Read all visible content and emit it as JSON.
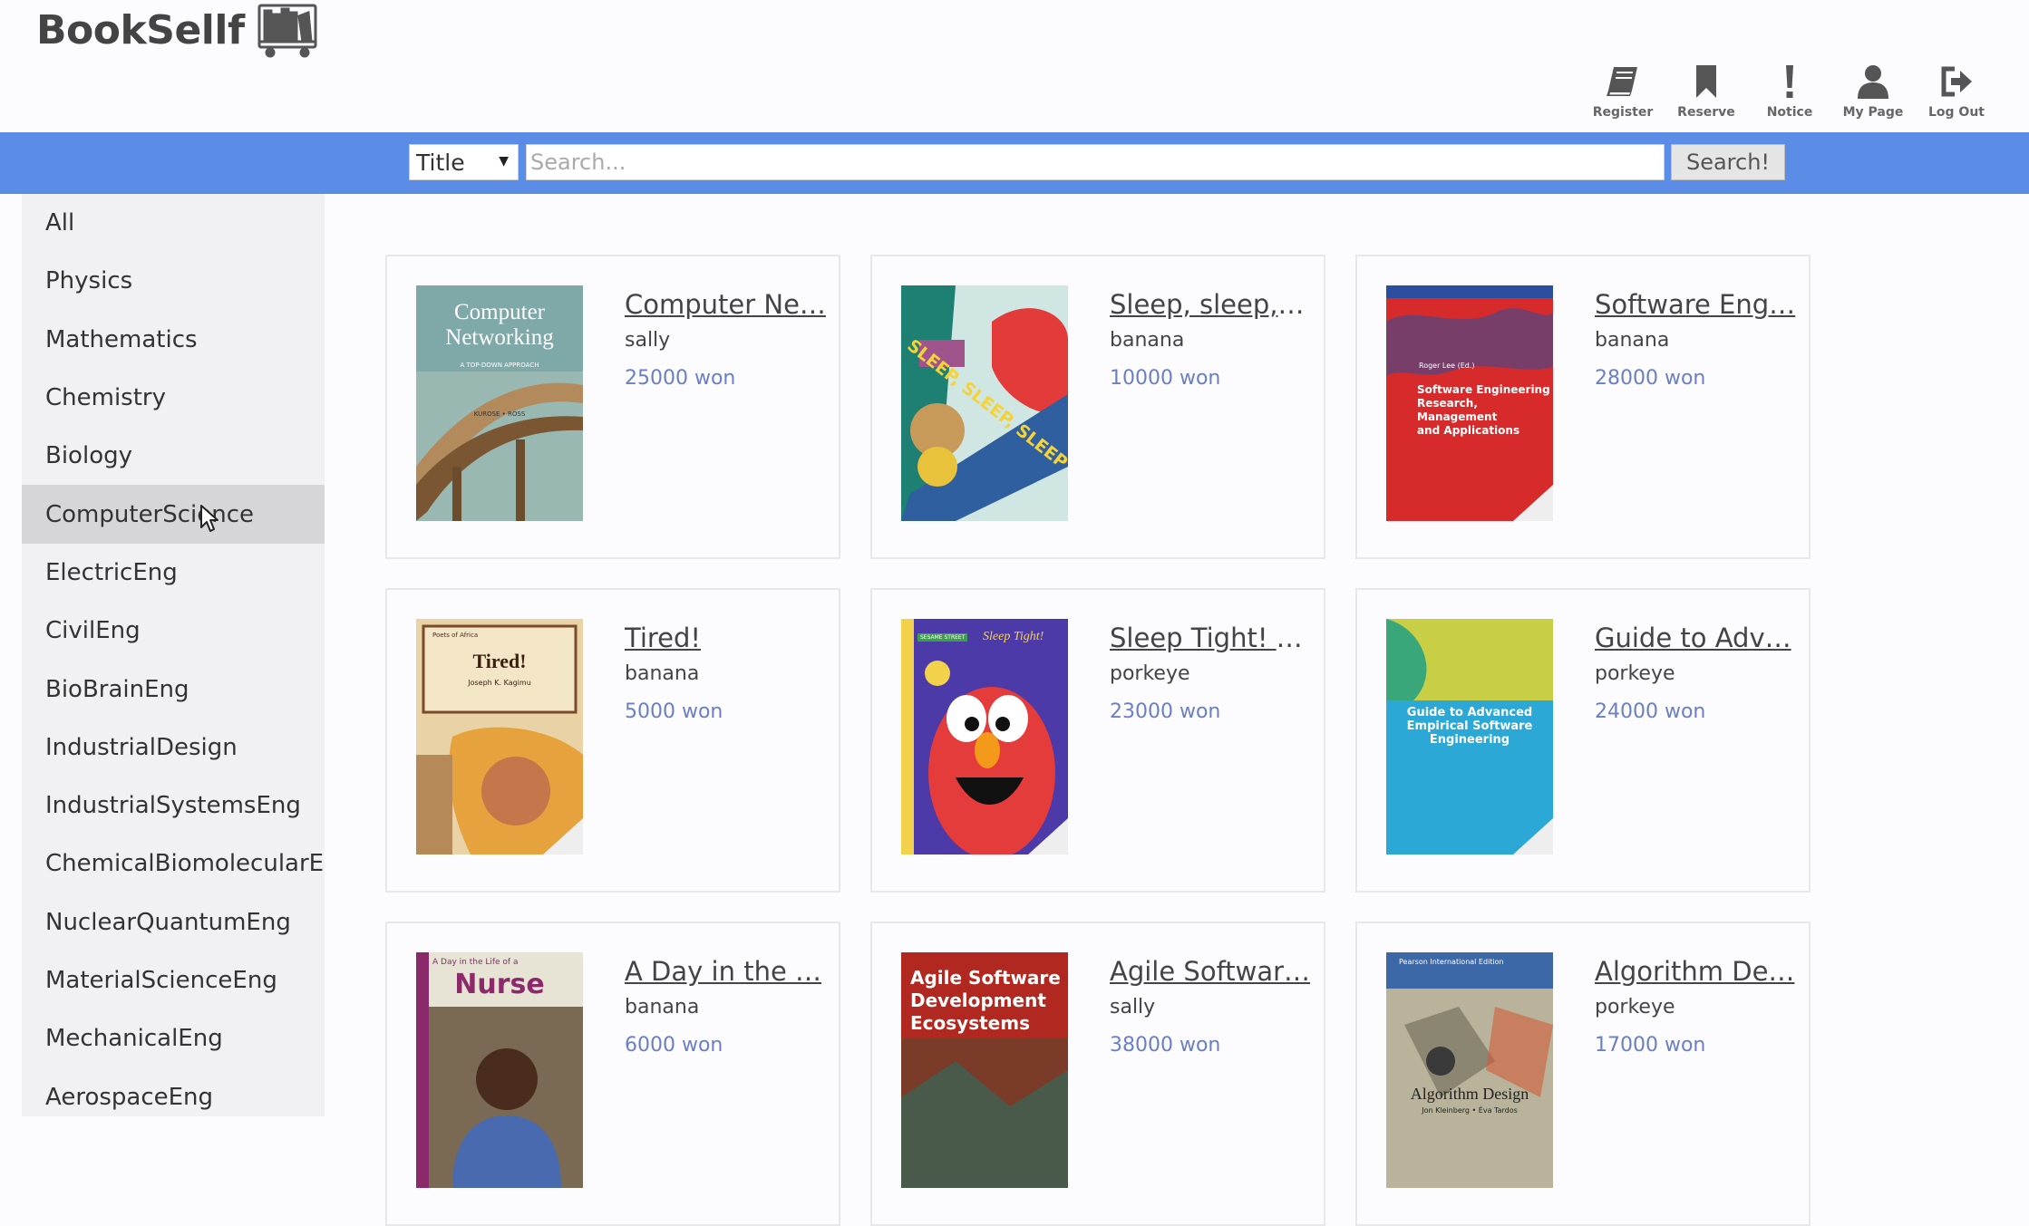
{
  "app": {
    "logo_text": "BookSellf"
  },
  "nav": [
    {
      "label": "Register",
      "icon": "book-icon"
    },
    {
      "label": "Reserve",
      "icon": "bookmark-icon"
    },
    {
      "label": "Notice",
      "icon": "exclamation-icon"
    },
    {
      "label": "My Page",
      "icon": "user-icon"
    },
    {
      "label": "Log Out",
      "icon": "logout-icon"
    }
  ],
  "search": {
    "field_value": "Title",
    "placeholder": "Search...",
    "button_label": "Search!"
  },
  "colors": {
    "search_bar": "#5b8de6",
    "price": "#6a7fc6",
    "sidebar": "#f1f0f2",
    "sidebar_active": "#d6d5d8"
  },
  "categories": [
    "All",
    "Physics",
    "Mathematics",
    "Chemistry",
    "Biology",
    "ComputerScience",
    "ElectricEng",
    "CivilEng",
    "BioBrainEng",
    "IndustrialDesign",
    "IndustrialSystemsEng",
    "ChemicalBiomolecularEn",
    "NuclearQuantumEng",
    "MaterialScienceEng",
    "MechanicalEng",
    "AerospaceEng"
  ],
  "active_category": "ComputerScience",
  "books": [
    {
      "title": "Computer Ne…",
      "seller": "sally",
      "price": "25000 won",
      "cover_text": [
        "Computer",
        "Networking",
        "A TOP-DOWN APPROACH",
        "KUROSE • ROSS"
      ]
    },
    {
      "title": "Sleep, sleep, …",
      "seller": "banana",
      "price": "10000 won",
      "cover_text": [
        "SLEEP, SLEEP, SLEEP"
      ]
    },
    {
      "title": "Software Eng…",
      "seller": "banana",
      "price": "28000 won",
      "cover_text": [
        "Roger Lee (Ed.)",
        "Software Engineering",
        "Research, Management",
        "and Applications"
      ]
    },
    {
      "title": "Tired!",
      "seller": "banana",
      "price": "5000 won",
      "cover_text": [
        "Poets of Africa",
        "Tired!",
        "Joseph K. Kagimu"
      ]
    },
    {
      "title": "Sleep Tight! (…",
      "seller": "porkeye",
      "price": "23000 won",
      "cover_text": [
        "Sleep Tight!",
        "SESAME STREET"
      ]
    },
    {
      "title": "Guide to Adv…",
      "seller": "porkeye",
      "price": "24000 won",
      "cover_text": [
        "Guide to Advanced",
        "Empirical Software",
        "Engineering"
      ]
    },
    {
      "title": "A Day in the …",
      "seller": "banana",
      "price": "6000 won",
      "cover_text": [
        "A Day in the Life of a",
        "Nurse"
      ]
    },
    {
      "title": "Agile Softwar…",
      "seller": "sally",
      "price": "38000 won",
      "cover_text": [
        "Agile Software",
        "Development",
        "Ecosystems"
      ]
    },
    {
      "title": "Algorithm De…",
      "seller": "porkeye",
      "price": "17000 won",
      "cover_text": [
        "Pearson International Edition",
        "Algorithm Design",
        "Jon Kleinberg • Éva Tardos"
      ]
    }
  ]
}
